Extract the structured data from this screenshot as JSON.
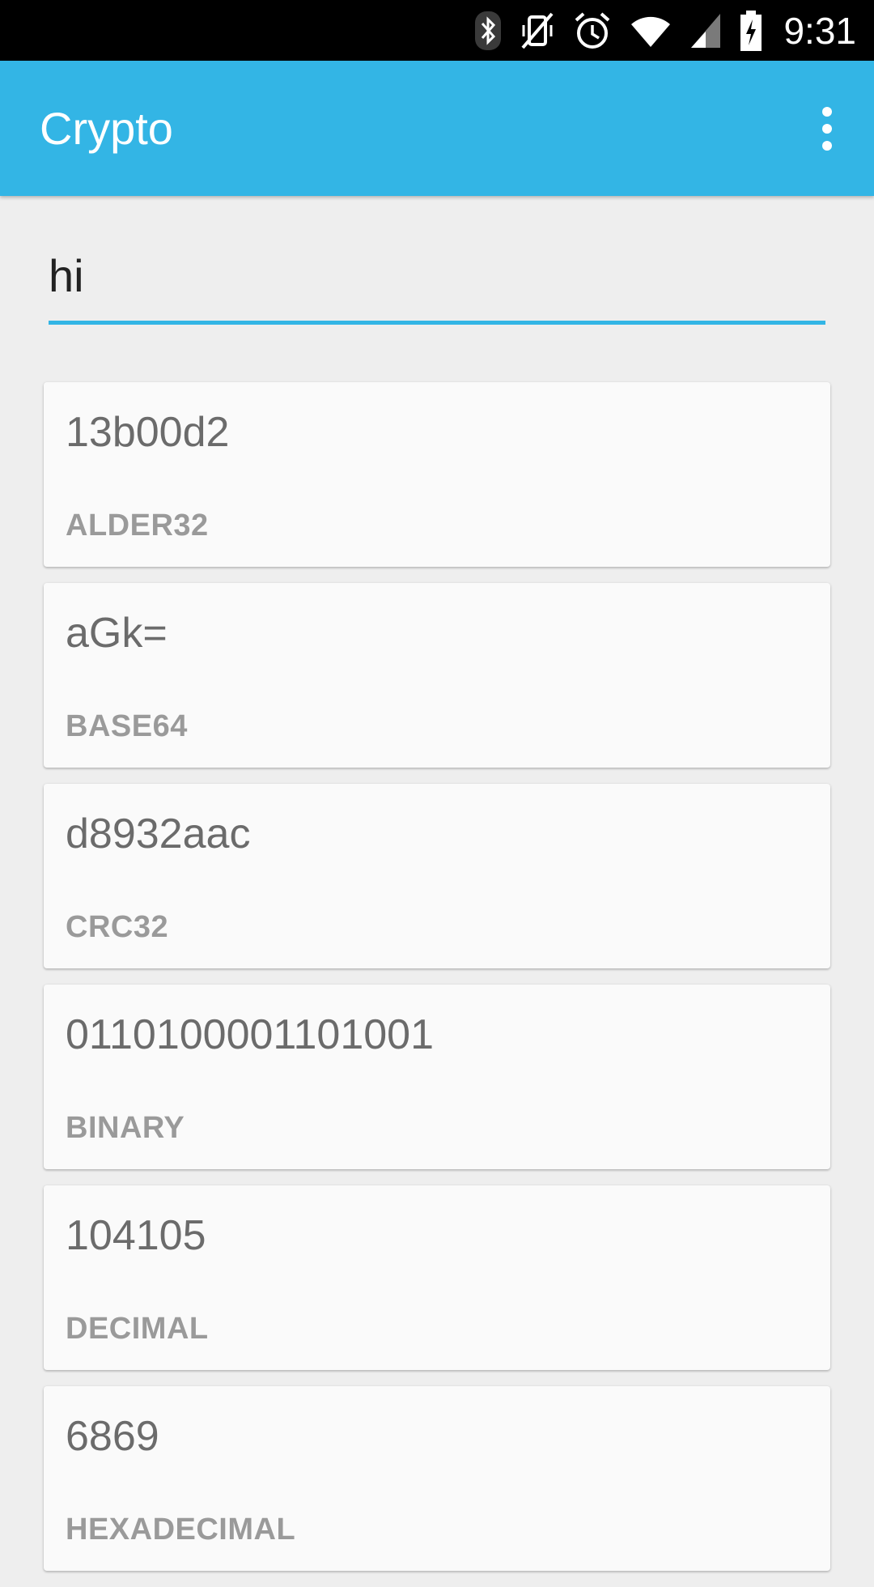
{
  "status_bar": {
    "icons": [
      "bluetooth-icon",
      "vibrate-off-icon",
      "alarm-icon",
      "wifi-icon",
      "cell-signal-icon",
      "battery-charging-icon"
    ],
    "time": "9:31"
  },
  "app_bar": {
    "title": "Crypto",
    "overflow_icon": "more-vert-icon",
    "color": "#33B5E5"
  },
  "input": {
    "value": "hi"
  },
  "results": [
    {
      "value": "13b00d2",
      "label": "ALDER32"
    },
    {
      "value": "aGk=",
      "label": "BASE64"
    },
    {
      "value": "d8932aac",
      "label": "CRC32"
    },
    {
      "value": "0110100001101001",
      "label": "BINARY"
    },
    {
      "value": "104105",
      "label": "DECIMAL"
    },
    {
      "value": "6869",
      "label": "HEXADECIMAL"
    }
  ]
}
